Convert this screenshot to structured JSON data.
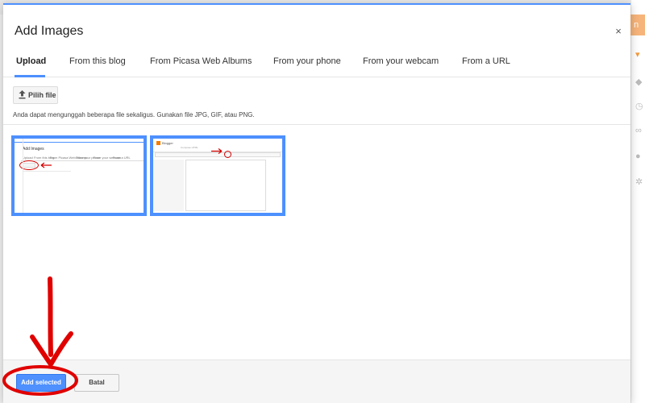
{
  "dialog": {
    "title": "Add Images",
    "close_glyph": "×"
  },
  "tabs": [
    {
      "label": "Upload",
      "active": true
    },
    {
      "label": "From this blog",
      "active": false
    },
    {
      "label": "From Picasa Web Albums",
      "active": false
    },
    {
      "label": "From your phone",
      "active": false
    },
    {
      "label": "From your webcam",
      "active": false
    },
    {
      "label": "From a URL",
      "active": false
    }
  ],
  "upload": {
    "button_label": "Pilih file",
    "button_icon": "upload-icon",
    "hint": "Anda dapat mengunggah beberapa file sekaligus. Gunakan file JPG, GIF, atau PNG."
  },
  "thumbnails": [
    {
      "selected": true,
      "mini_title": "Add Images",
      "mini_tabs": [
        "Upload",
        "From this blog",
        "From Picasa Web Albums",
        "From your phone",
        "From your webcam",
        "From a URL"
      ],
      "mini_button": "Pilih file"
    },
    {
      "selected": true,
      "mini_brand": "Blogger",
      "mini_toolbar_hint": "Compose  HTML"
    }
  ],
  "footer": {
    "add_selected_label": "Add selected",
    "cancel_label": "Batal"
  },
  "background": {
    "orange_tab_text": "n",
    "side_icons": [
      "caret-down-icon",
      "tag-icon",
      "clock-icon",
      "link-icon",
      "location-icon",
      "gear-icon"
    ]
  },
  "colors": {
    "accent": "#4d90fe",
    "annotation_red": "#e00000",
    "orange": "#f6b47a"
  }
}
